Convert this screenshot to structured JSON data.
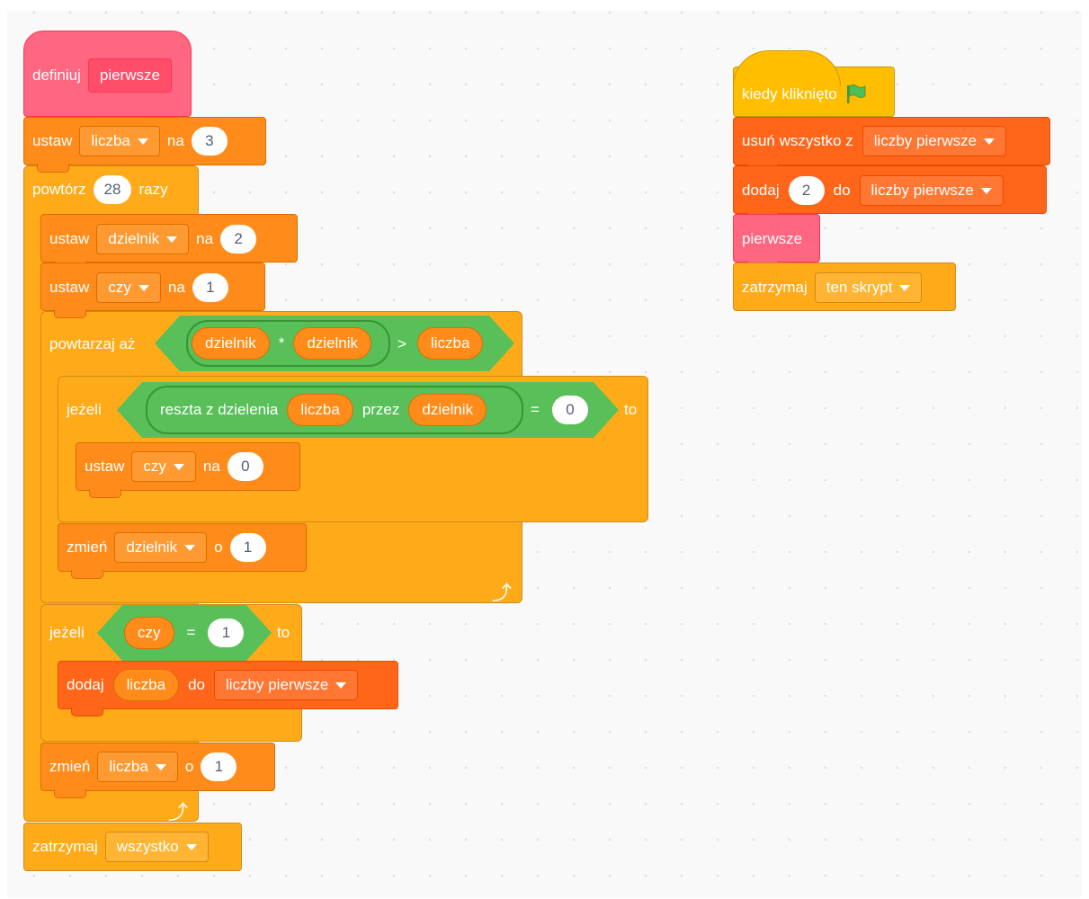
{
  "left_script": {
    "define": {
      "label": "definiuj",
      "block_name": "pierwsze"
    },
    "set_liczba": {
      "label": "ustaw",
      "var": "liczba",
      "to": "na",
      "value": "3"
    },
    "repeat": {
      "label": "powtórz",
      "count": "28",
      "suffix": "razy"
    },
    "set_dzielnik": {
      "label": "ustaw",
      "var": "dzielnik",
      "to": "na",
      "value": "2"
    },
    "set_czy": {
      "label": "ustaw",
      "var": "czy",
      "to": "na",
      "value": "1"
    },
    "repeat_until": {
      "label": "powtarzaj aż",
      "left": "dzielnik",
      "mul": "*",
      "right": "dzielnik",
      "gt": ">",
      "target": "liczba"
    },
    "if1": {
      "label": "jeżeli",
      "mod_label": "reszta z dzielenia",
      "mod_a": "liczba",
      "mod_by": "przez",
      "mod_b": "dzielnik",
      "eq": "=",
      "value": "0",
      "then": "to"
    },
    "set_czy0": {
      "label": "ustaw",
      "var": "czy",
      "to": "na",
      "value": "0"
    },
    "change_dzielnik": {
      "label": "zmień",
      "var": "dzielnik",
      "by": "o",
      "value": "1"
    },
    "if2": {
      "label": "jeżeli",
      "var": "czy",
      "eq": "=",
      "value": "1",
      "then": "to"
    },
    "add_item": {
      "label": "dodaj",
      "item": "liczba",
      "to": "do",
      "list": "liczby pierwsze"
    },
    "change_liczba": {
      "label": "zmień",
      "var": "liczba",
      "by": "o",
      "value": "1"
    },
    "stop": {
      "label": "zatrzymaj",
      "option": "wszystko"
    }
  },
  "right_script": {
    "when_flag": {
      "label": "kiedy kliknięto",
      "icon": "green-flag-icon"
    },
    "delete_all": {
      "label": "usuń wszystko z",
      "list": "liczby pierwsze"
    },
    "add": {
      "label": "dodaj",
      "value": "2",
      "to": "do",
      "list": "liczby pierwsze"
    },
    "call": {
      "label": "pierwsze"
    },
    "stop": {
      "label": "zatrzymaj",
      "option": "ten skrypt"
    }
  },
  "colors": {
    "control": "#ffab19",
    "variables": "#ff8c1a",
    "lists": "#ff661a",
    "my_blocks": "#ff6680",
    "events": "#ffbf00",
    "operators": "#59c059"
  }
}
